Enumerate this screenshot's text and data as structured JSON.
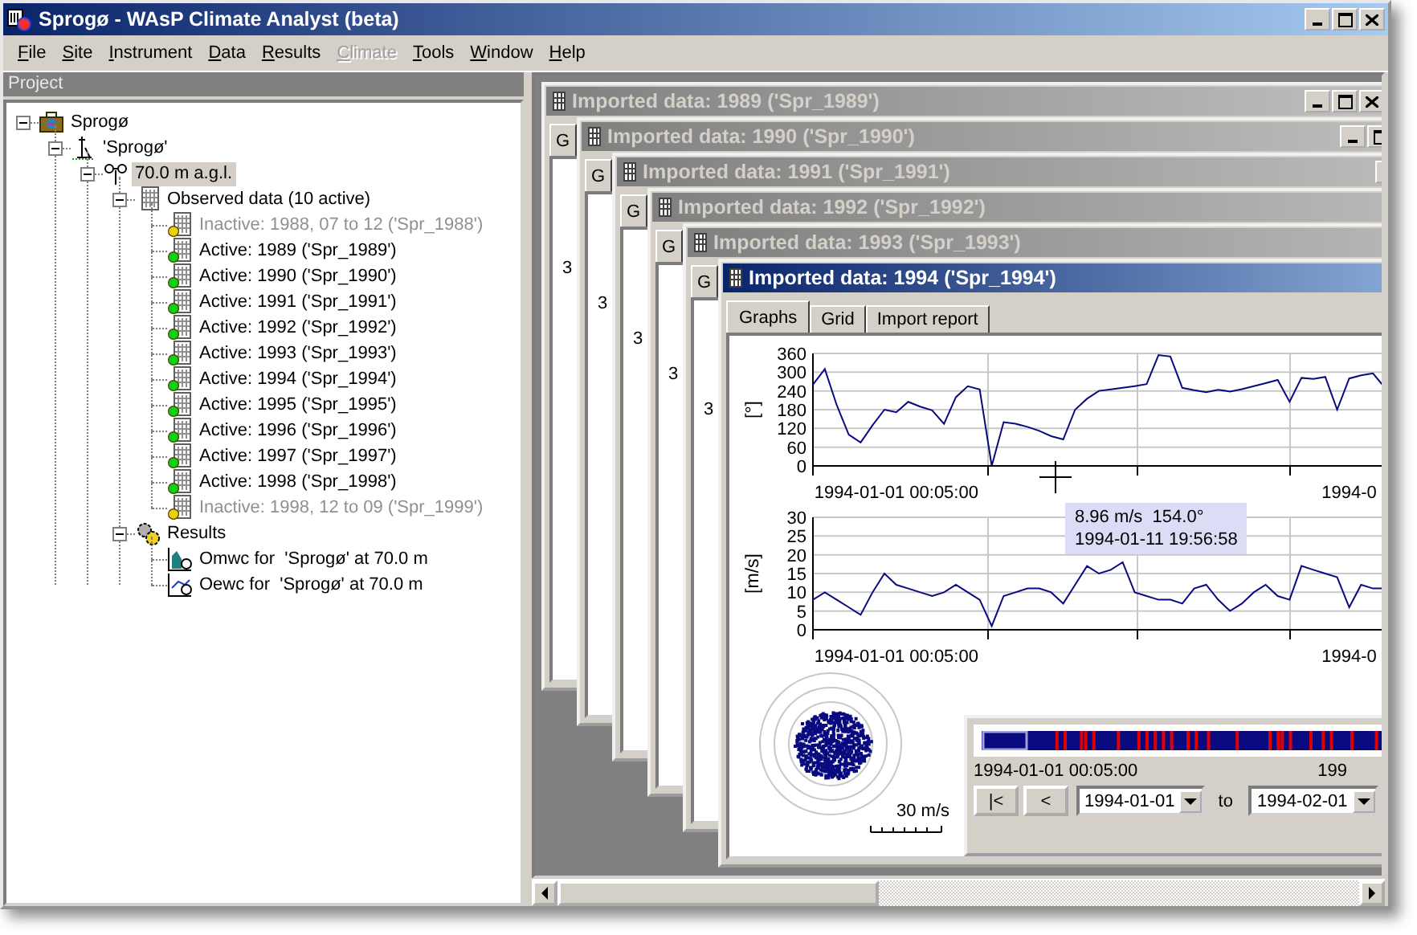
{
  "window": {
    "title": "Sprogø - WAsP Climate Analyst (beta)"
  },
  "menu": [
    {
      "label": "File",
      "disabled": false
    },
    {
      "label": "Site",
      "disabled": false
    },
    {
      "label": "Instrument",
      "disabled": false
    },
    {
      "label": "Data",
      "disabled": false
    },
    {
      "label": "Results",
      "disabled": false
    },
    {
      "label": "Climate",
      "disabled": true
    },
    {
      "label": "Tools",
      "disabled": false
    },
    {
      "label": "Window",
      "disabled": false
    },
    {
      "label": "Help",
      "disabled": false
    }
  ],
  "project_panel": {
    "title": "Project",
    "tree": [
      {
        "label": "Sprogø",
        "kind": "project",
        "expanded": true,
        "selected": false,
        "children": [
          {
            "label": "'Sprogø'",
            "kind": "site",
            "expanded": true,
            "selected": false,
            "children": [
              {
                "label": "70.0 m a.g.l.",
                "kind": "mast",
                "expanded": true,
                "selected": true,
                "children": [
                  {
                    "label": "Observed data (10 active)",
                    "kind": "dataset-group",
                    "expanded": true,
                    "selected": false,
                    "children": [
                      {
                        "label": "Inactive: 1988, 07 to 12 ('Spr_1988')",
                        "kind": "dataset",
                        "active": false,
                        "selected": false
                      },
                      {
                        "label": "Active: 1989 ('Spr_1989')",
                        "kind": "dataset",
                        "active": true,
                        "selected": false
                      },
                      {
                        "label": "Active: 1990 ('Spr_1990')",
                        "kind": "dataset",
                        "active": true,
                        "selected": false
                      },
                      {
                        "label": "Active: 1991 ('Spr_1991')",
                        "kind": "dataset",
                        "active": true,
                        "selected": false
                      },
                      {
                        "label": "Active: 1992 ('Spr_1992')",
                        "kind": "dataset",
                        "active": true,
                        "selected": false
                      },
                      {
                        "label": "Active: 1993 ('Spr_1993')",
                        "kind": "dataset",
                        "active": true,
                        "selected": false
                      },
                      {
                        "label": "Active: 1994 ('Spr_1994')",
                        "kind": "dataset",
                        "active": true,
                        "selected": false
                      },
                      {
                        "label": "Active: 1995 ('Spr_1995')",
                        "kind": "dataset",
                        "active": true,
                        "selected": false
                      },
                      {
                        "label": "Active: 1996 ('Spr_1996')",
                        "kind": "dataset",
                        "active": true,
                        "selected": false
                      },
                      {
                        "label": "Active: 1997 ('Spr_1997')",
                        "kind": "dataset",
                        "active": true,
                        "selected": false
                      },
                      {
                        "label": "Active: 1998 ('Spr_1998')",
                        "kind": "dataset",
                        "active": true,
                        "selected": false
                      },
                      {
                        "label": "Inactive: 1998, 12 to 09 ('Spr_1999')",
                        "kind": "dataset",
                        "active": false,
                        "selected": false
                      }
                    ]
                  },
                  {
                    "label": "Results",
                    "kind": "results",
                    "expanded": true,
                    "selected": false,
                    "children": [
                      {
                        "label": "Omwc for  'Sprogø' at 70.0 m",
                        "kind": "omwc-result",
                        "selected": false
                      },
                      {
                        "label": "Oewc for  'Sprogø' at 70.0 m",
                        "kind": "oewc-result",
                        "selected": false
                      }
                    ]
                  }
                ]
              }
            ]
          }
        ]
      }
    ]
  },
  "mdi_windows": [
    {
      "title": "Imported data: 1989 ('Spr_1989')",
      "active": false,
      "tab": "G",
      "axis_fragment": "3"
    },
    {
      "title": "Imported data: 1990 ('Spr_1990')",
      "active": false,
      "tab": "G",
      "axis_fragment": "3"
    },
    {
      "title": "Imported data: 1991 ('Spr_1991')",
      "active": false,
      "tab": "G",
      "axis_fragment": "3"
    },
    {
      "title": "Imported data: 1992 ('Spr_1992')",
      "active": false,
      "tab": "G",
      "axis_fragment": "3"
    },
    {
      "title": "Imported data: 1993 ('Spr_1993')",
      "active": false,
      "tab": "G",
      "axis_fragment": "3"
    },
    {
      "title": "Imported data: 1994 ('Spr_1994')",
      "active": true,
      "tabs": [
        {
          "label": "Graphs",
          "selected": true
        },
        {
          "label": "Grid",
          "selected": false
        },
        {
          "label": "Import report",
          "selected": false
        }
      ],
      "view": {
        "direction_plot": {
          "chart_data": {
            "type": "line",
            "grid": true,
            "ylabel": "[°]",
            "ylim": [
              0,
              360
            ],
            "yticks": [
              0,
              60,
              120,
              180,
              240,
              300,
              360
            ],
            "categories": [
              null,
              null,
              null,
              null,
              null,
              null,
              null,
              "1994-01-01 00:05:00",
              null,
              null,
              null,
              null,
              null,
              null,
              null,
              null,
              null,
              null,
              null,
              null,
              null,
              null,
              null,
              null,
              null,
              null,
              null,
              null,
              null,
              null,
              null,
              null,
              null,
              null,
              null,
              null,
              null,
              null,
              null,
              null,
              null,
              null,
              null,
              null,
              null,
              "1994-0",
              null,
              null,
              null
            ],
            "series": [
              {
                "color": "#0a0a80",
                "values": [
                  260,
                  310,
                  195,
                  100,
                  75,
                  130,
                  180,
                  172,
                  205,
                  190,
                  178,
                  135,
                  220,
                  255,
                  245,
                  0,
                  140,
                  135,
                  125,
                  112,
                  95,
                  85,
                  180,
                  215,
                  240,
                  245,
                  250,
                  255,
                  262,
                  355,
                  350,
                  250,
                  242,
                  236,
                  244,
                  238,
                  246,
                  255,
                  265,
                  275,
                  205,
                  282,
                  278,
                  285,
                  180,
                  280,
                  290,
                  296,
                  250
                ]
              }
            ]
          }
        },
        "speed_plot": {
          "chart_data": {
            "type": "line",
            "grid": true,
            "ylabel": "[m/s]",
            "ylim": [
              0,
              30
            ],
            "yticks": [
              0,
              5,
              10,
              15,
              20,
              25,
              30
            ],
            "categories": [
              null,
              null,
              null,
              null,
              null,
              null,
              null,
              "1994-01-01 00:05:00",
              null,
              null,
              null,
              null,
              null,
              null,
              null,
              null,
              null,
              null,
              null,
              null,
              null,
              null,
              null,
              null,
              null,
              null,
              null,
              null,
              null,
              null,
              null,
              null,
              null,
              null,
              null,
              null,
              null,
              null,
              null,
              null,
              null,
              null,
              null,
              null,
              null,
              "1994-0",
              null,
              null,
              null
            ],
            "series": [
              {
                "color": "#0a0a80",
                "values": [
                  8,
                  10,
                  8,
                  6,
                  4,
                  10,
                  15,
                  12,
                  11,
                  10,
                  9,
                  10,
                  12,
                  10,
                  8,
                  1,
                  9,
                  10,
                  11,
                  11,
                  10,
                  7,
                  12,
                  17,
                  15,
                  16,
                  18,
                  10,
                  9,
                  8,
                  8,
                  7,
                  11,
                  12,
                  8,
                  5,
                  7,
                  10,
                  12,
                  9,
                  8,
                  17,
                  16,
                  15,
                  14,
                  6,
                  12,
                  11,
                  11
                ]
              }
            ]
          }
        },
        "tooltip": [
          "8.96 m/s  154.0°",
          "1994-01-11 19:56:58"
        ],
        "rose": {
          "scale_label": "30 m/s"
        },
        "timeline": {
          "start_label": "1994-01-01 00:05:00",
          "end_label": "199"
        },
        "nav": {
          "first": "|<",
          "prev": "<",
          "from": "1994-01-01",
          "to_label": "to",
          "to": "1994-02-01"
        }
      }
    }
  ]
}
